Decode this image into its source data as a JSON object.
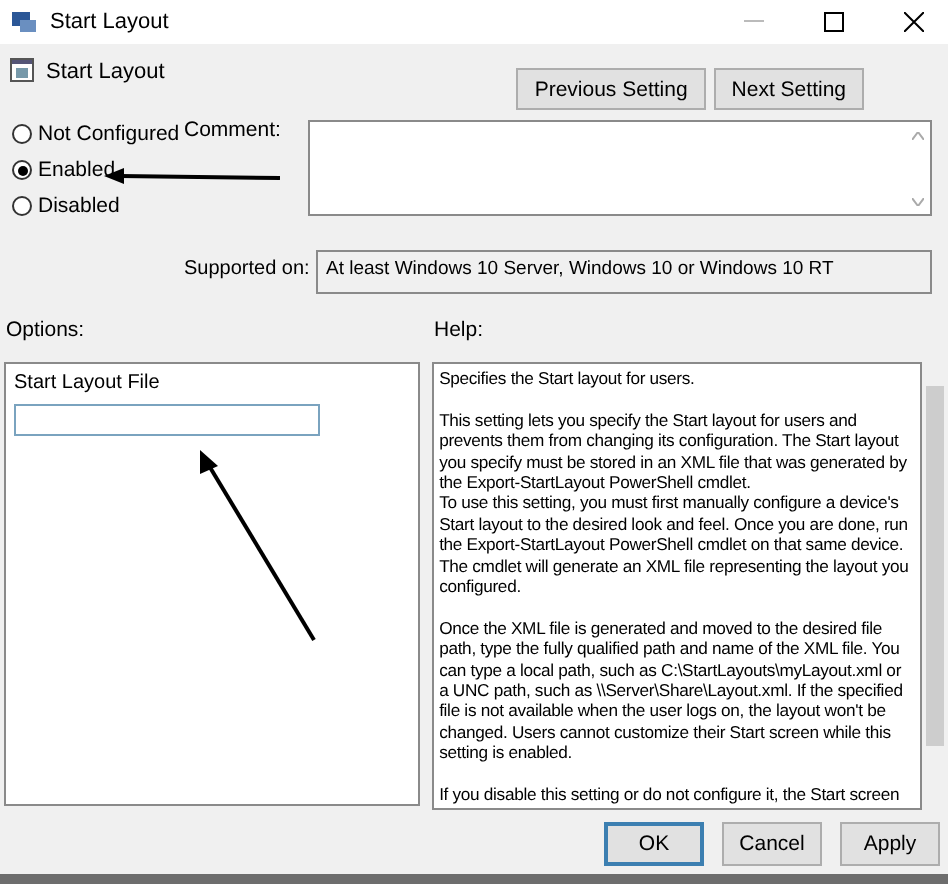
{
  "window": {
    "title": "Start Layout"
  },
  "header": {
    "title": "Start Layout",
    "buttons": [
      "Previous Setting",
      "Next Setting"
    ]
  },
  "states": [
    {
      "label": "Not Configured",
      "selected": false
    },
    {
      "label": "Enabled",
      "selected": true
    },
    {
      "label": "Disabled",
      "selected": false
    }
  ],
  "comment": {
    "label": "Comment:"
  },
  "supported_on": {
    "label": "Supported on:",
    "value": "At least Windows 10 Server, Windows 10 or Windows 10 RT"
  },
  "options": {
    "label": "Options:",
    "field_label": "Start Layout File"
  },
  "help": {
    "label": "Help:",
    "paragraphs": [
      [
        "Specifies the Start layout for users."
      ],
      [
        "This setting lets you specify the Start layout for users and prevents them from changing its configuration. The Start layout you specify must be stored in an XML file that was generated by the Export-StartLayout PowerShell cmdlet.",
        "To use this setting, you must first manually configure a device's Start layout to the desired look and feel. Once you are done, run the Export-StartLayout PowerShell cmdlet on that same device. The cmdlet will generate an XML file representing the layout you configured."
      ],
      [
        "Once the XML file is generated and moved to the desired file path, type the fully qualified path and name of the XML file. You can type a local path, such as C:\\StartLayouts\\myLayout.xml or a UNC path, such as \\\\Server\\Share\\Layout.xml. If the specified file is not available when the user logs on, the layout won't be changed. Users cannot customize their Start screen while this setting is enabled."
      ],
      [
        "If you disable this setting or do not configure it, the Start screen"
      ]
    ]
  },
  "buttons": [
    {
      "label": "OK",
      "selected": true
    },
    {
      "label": "Cancel",
      "selected": false
    },
    {
      "label": "Apply",
      "selected": false
    }
  ]
}
